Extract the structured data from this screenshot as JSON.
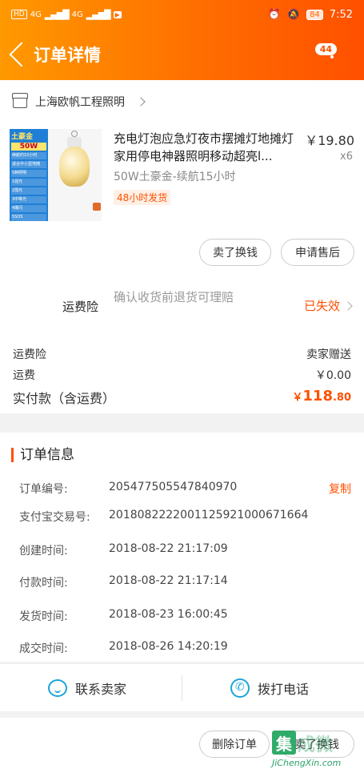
{
  "status_bar": {
    "left": [
      "HD",
      "4G",
      "4G"
    ],
    "battery": "84",
    "time": "7:52"
  },
  "header": {
    "title": "订单详情",
    "badge": "44"
  },
  "shop": {
    "name": "上海欧帆工程照明"
  },
  "product": {
    "thumb_text": [
      "土豪金",
      "50W",
      "续航约10小时",
      "适合中小型地摊",
      "5种照明",
      "1强光",
      "2弱光",
      "3中等光",
      "4爆闪",
      "5SOS"
    ],
    "title": "充电灯泡应急灯夜市摆摊灯地摊灯家用停电神器照明移动超亮l...",
    "price": "￥19.80",
    "qty": "x6",
    "spec": "50W土豪金-续航15小时",
    "tag": "48小时发货"
  },
  "buttons": {
    "sell_swap": "卖了换钱",
    "after_sale": "申请售后",
    "delete_order": "删除订单",
    "sell_swap_bottom": "卖了换钱"
  },
  "insurance": {
    "label": "运费险",
    "desc": "确认收货前退货可理赔",
    "status": "已失效"
  },
  "fees": {
    "ins_label": "运费险",
    "ins_value": "卖家赠送",
    "ship_label": "运费",
    "ship_value": "￥0.00",
    "paid_label": "实付款（含运费）",
    "paid_currency": "￥",
    "paid_int": "118",
    "paid_dec": ".80"
  },
  "order_info": {
    "title": "订单信息",
    "copy": "复制",
    "rows": [
      {
        "label": "订单编号:",
        "value": "205477505547840970"
      },
      {
        "label": "支付宝交易号:",
        "value": "2018082222001125921000671664"
      },
      {
        "label": "创建时间:",
        "value": "2018-08-22 21:17:09"
      },
      {
        "label": "付款时间:",
        "value": "2018-08-22 21:17:14"
      },
      {
        "label": "发货时间:",
        "value": "2018-08-23 16:00:45"
      },
      {
        "label": "成交时间:",
        "value": "2018-08-26 14:20:19"
      }
    ]
  },
  "actions": {
    "contact_seller": "联系卖家",
    "call_phone": "拨打电话"
  },
  "watermark": {
    "char": "集",
    "text": "成微",
    "url": "JiChengXin.com"
  },
  "colors": {
    "accent": "#ff5000",
    "header_start": "#ff9900",
    "icon_blue": "#1ca4d6"
  }
}
